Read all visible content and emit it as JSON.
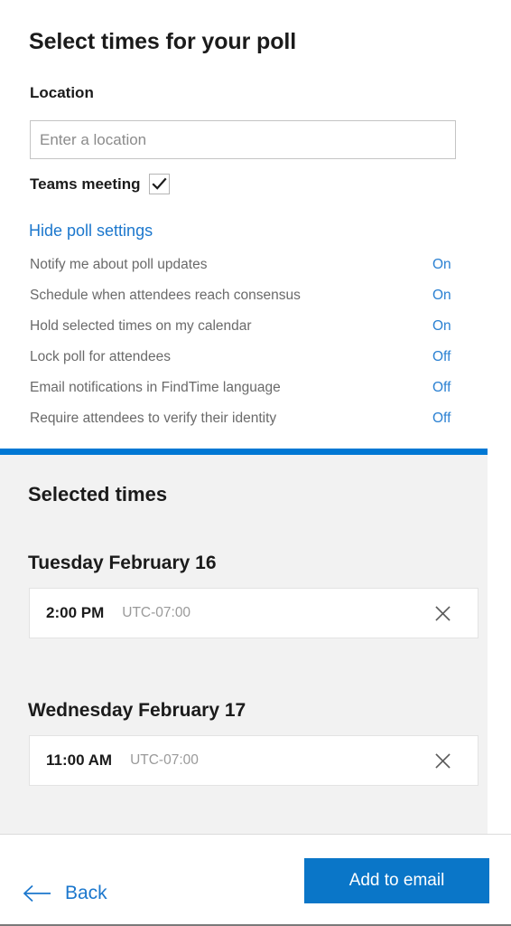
{
  "page": {
    "title": "Select times for your poll"
  },
  "location": {
    "label": "Location",
    "placeholder": "Enter a location",
    "value": ""
  },
  "teams": {
    "label": "Teams meeting",
    "checked": true,
    "check_icon": "checkmark-icon"
  },
  "poll_settings": {
    "toggle_link": "Hide poll settings",
    "items": [
      {
        "name": "Notify me about poll updates",
        "value": "On"
      },
      {
        "name": "Schedule when attendees reach consensus",
        "value": "On"
      },
      {
        "name": "Hold selected times on my calendar",
        "value": "On"
      },
      {
        "name": "Lock poll for attendees",
        "value": "Off"
      },
      {
        "name": "Email notifications in FindTime language",
        "value": "Off"
      },
      {
        "name": "Require attendees to verify their identity",
        "value": "Off"
      }
    ]
  },
  "selected_times": {
    "title": "Selected times",
    "days": [
      {
        "date": "Tuesday February 16",
        "slots": [
          {
            "time": "2:00 PM",
            "timezone": "UTC-07:00",
            "remove_icon": "close-icon"
          }
        ]
      },
      {
        "date": "Wednesday February 17",
        "slots": [
          {
            "time": "11:00 AM",
            "timezone": "UTC-07:00",
            "remove_icon": "close-icon"
          }
        ]
      }
    ]
  },
  "footer": {
    "back_label": "Back",
    "back_icon": "arrow-left-icon",
    "primary_label": "Add to email"
  },
  "colors": {
    "accent": "#0078d4",
    "link": "#1b77cd",
    "panel_background": "#f2f2f2",
    "primary_button": "#0a76c8",
    "setting_label": "#6a6a6a",
    "muted_text": "#9a9a9a"
  }
}
